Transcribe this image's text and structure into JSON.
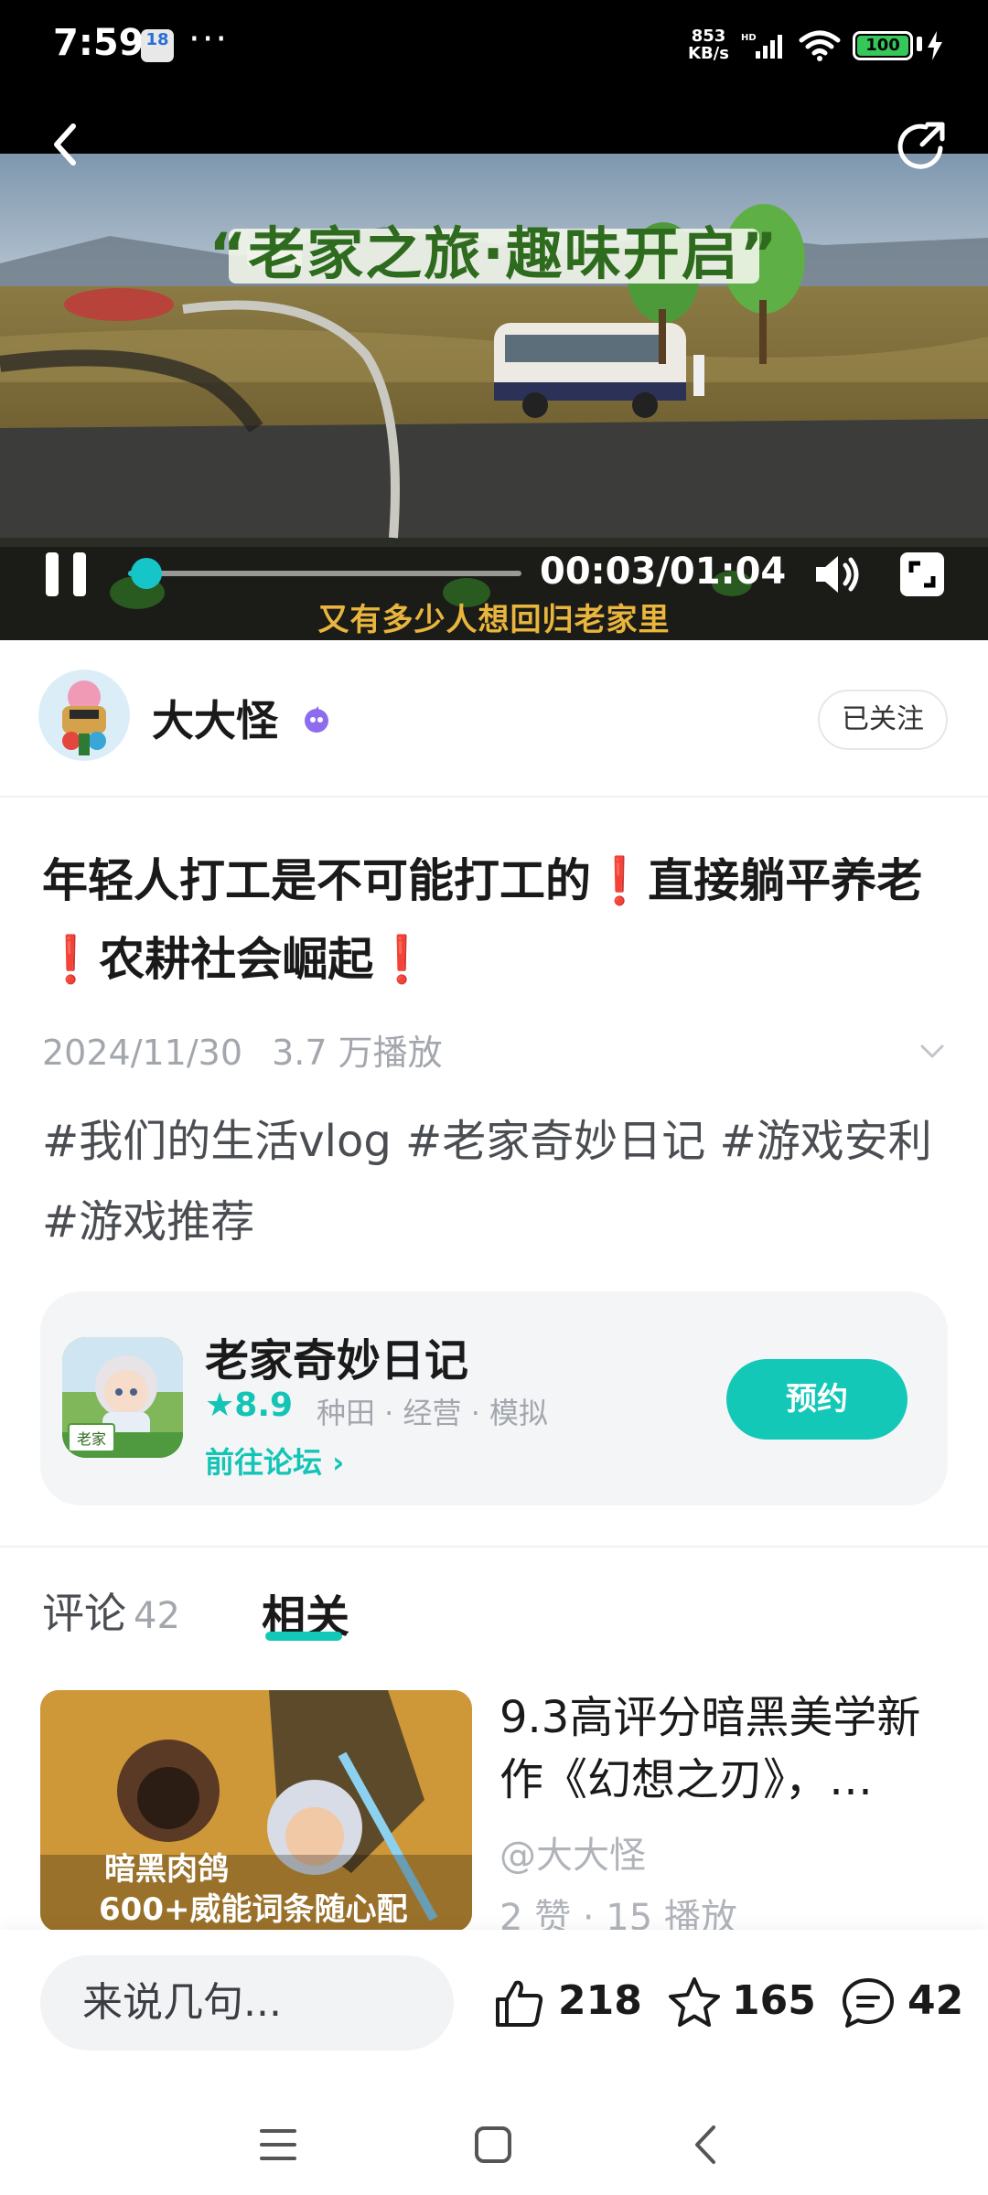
{
  "status_bar": {
    "time": "7:59",
    "badge_text": "18",
    "more": "···",
    "net_speed_value": "853",
    "net_speed_unit": "KB/s",
    "battery": "100"
  },
  "video": {
    "banner_text": "“老家之旅·趣味开启”",
    "subtitle": "又有多少人想回归老家里",
    "time_display": "00:03/01:04",
    "progress": 0.047
  },
  "author": {
    "name": "大大怪",
    "follow_label": "已关注"
  },
  "post": {
    "title_parts": [
      "年轻人打工是不可能打工的",
      "❗",
      "直接躺平养老",
      "❗",
      "农耕社会崛起",
      "❗"
    ],
    "date": "2024/11/30",
    "plays": "3.7 万播放",
    "hashtags": "#我们的生活vlog #老家奇妙日记 #游戏安利 #游戏推荐"
  },
  "game": {
    "name": "老家奇妙日记",
    "rating": "★8.9",
    "tags": "种田 · 经营 · 模拟",
    "forum_link": "前往论坛 ›",
    "icon_label": "老家",
    "reserve_label": "预约"
  },
  "tabs": {
    "comments_label": "评论",
    "comments_count": "42",
    "related_label": "相关"
  },
  "related": {
    "title": "9.3高评分暗黑美学新作《幻想之刃》，…",
    "author": "@大大怪",
    "stats": "2 赞 · 15 播放",
    "thumb_line1": "暗黑肉鸽",
    "thumb_line2": "600+威能词条随心配"
  },
  "bottom_bar": {
    "input_placeholder": "来说几句...",
    "likes": "218",
    "stars": "165",
    "comments": "42"
  },
  "colors": {
    "accent": "#14c8b8",
    "rating": "#14c4b5",
    "warning_red": "#e53935"
  }
}
